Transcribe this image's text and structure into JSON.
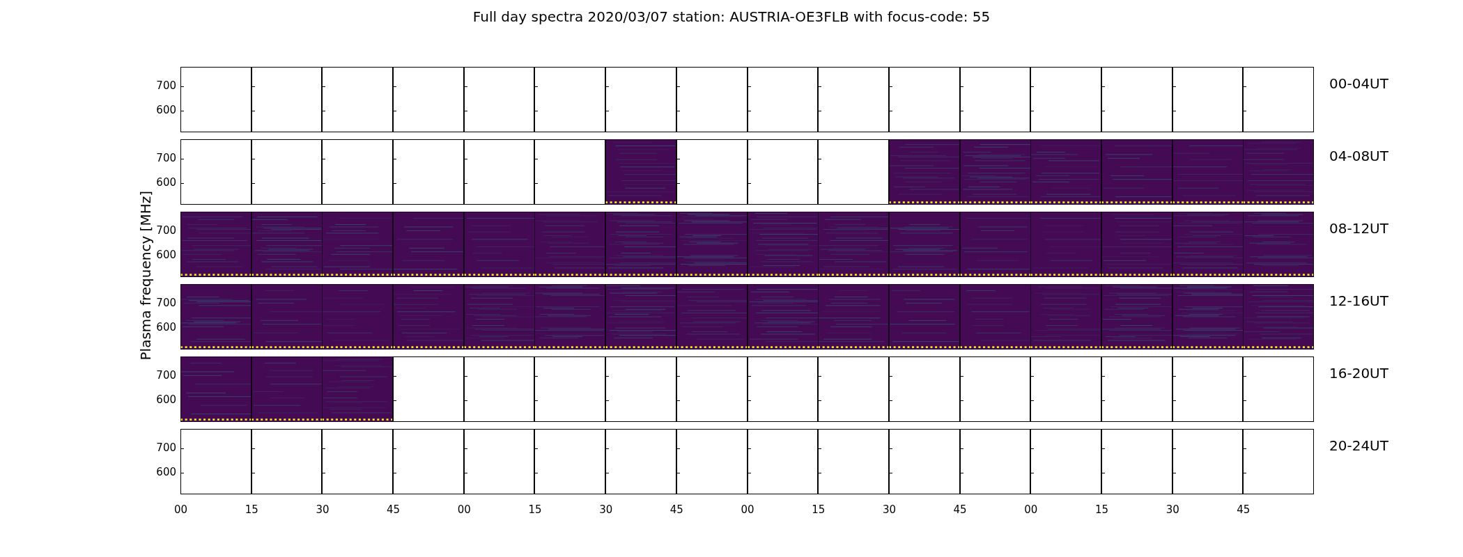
{
  "title": "Full day spectra 2020/03/07 station: AUSTRIA-OE3FLB with focus-code: 55",
  "ylabel": "Plasma frequency [MHz]",
  "xticks": [
    "00",
    "15",
    "30",
    "45",
    "00",
    "15",
    "30",
    "45",
    "00",
    "15",
    "30",
    "45",
    "00",
    "15",
    "30",
    "45"
  ],
  "rows": [
    {
      "label": "00-04UT",
      "yticks": [
        "700",
        "600"
      ],
      "panels": [
        {
          "has_data": false
        },
        {
          "has_data": false
        },
        {
          "has_data": false
        },
        {
          "has_data": false
        },
        {
          "has_data": false
        },
        {
          "has_data": false
        },
        {
          "has_data": false
        },
        {
          "has_data": false
        },
        {
          "has_data": false
        },
        {
          "has_data": false
        },
        {
          "has_data": false
        },
        {
          "has_data": false
        },
        {
          "has_data": false
        },
        {
          "has_data": false
        },
        {
          "has_data": false
        },
        {
          "has_data": false
        }
      ]
    },
    {
      "label": "04-08UT",
      "yticks": [
        "700",
        "600"
      ],
      "panels": [
        {
          "has_data": false
        },
        {
          "has_data": false
        },
        {
          "has_data": false
        },
        {
          "has_data": false
        },
        {
          "has_data": false
        },
        {
          "has_data": false
        },
        {
          "has_data": true
        },
        {
          "has_data": false
        },
        {
          "has_data": false
        },
        {
          "has_data": false
        },
        {
          "has_data": true
        },
        {
          "has_data": true
        },
        {
          "has_data": true
        },
        {
          "has_data": true
        },
        {
          "has_data": true
        },
        {
          "has_data": true
        }
      ]
    },
    {
      "label": "08-12UT",
      "yticks": [
        "700",
        "600"
      ],
      "panels": [
        {
          "has_data": true
        },
        {
          "has_data": true
        },
        {
          "has_data": true
        },
        {
          "has_data": true
        },
        {
          "has_data": true
        },
        {
          "has_data": true
        },
        {
          "has_data": true
        },
        {
          "has_data": true
        },
        {
          "has_data": true
        },
        {
          "has_data": true
        },
        {
          "has_data": true
        },
        {
          "has_data": true
        },
        {
          "has_data": true
        },
        {
          "has_data": true
        },
        {
          "has_data": true
        },
        {
          "has_data": true
        }
      ]
    },
    {
      "label": "12-16UT",
      "yticks": [
        "700",
        "600"
      ],
      "panels": [
        {
          "has_data": true
        },
        {
          "has_data": true
        },
        {
          "has_data": true
        },
        {
          "has_data": true
        },
        {
          "has_data": true
        },
        {
          "has_data": true
        },
        {
          "has_data": true
        },
        {
          "has_data": true
        },
        {
          "has_data": true
        },
        {
          "has_data": true
        },
        {
          "has_data": true
        },
        {
          "has_data": true
        },
        {
          "has_data": true
        },
        {
          "has_data": true
        },
        {
          "has_data": true
        },
        {
          "has_data": true
        }
      ]
    },
    {
      "label": "16-20UT",
      "yticks": [
        "700",
        "600"
      ],
      "panels": [
        {
          "has_data": true
        },
        {
          "has_data": true
        },
        {
          "has_data": true
        },
        {
          "has_data": false
        },
        {
          "has_data": false
        },
        {
          "has_data": false
        },
        {
          "has_data": false
        },
        {
          "has_data": false
        },
        {
          "has_data": false
        },
        {
          "has_data": false
        },
        {
          "has_data": false
        },
        {
          "has_data": false
        },
        {
          "has_data": false
        },
        {
          "has_data": false
        },
        {
          "has_data": false
        },
        {
          "has_data": false
        }
      ]
    },
    {
      "label": "20-24UT",
      "yticks": [
        "700",
        "600"
      ],
      "panels": [
        {
          "has_data": false
        },
        {
          "has_data": false
        },
        {
          "has_data": false
        },
        {
          "has_data": false
        },
        {
          "has_data": false
        },
        {
          "has_data": false
        },
        {
          "has_data": false
        },
        {
          "has_data": false
        },
        {
          "has_data": false
        },
        {
          "has_data": false
        },
        {
          "has_data": false
        },
        {
          "has_data": false
        },
        {
          "has_data": false
        },
        {
          "has_data": false
        },
        {
          "has_data": false
        },
        {
          "has_data": false
        }
      ]
    }
  ]
}
